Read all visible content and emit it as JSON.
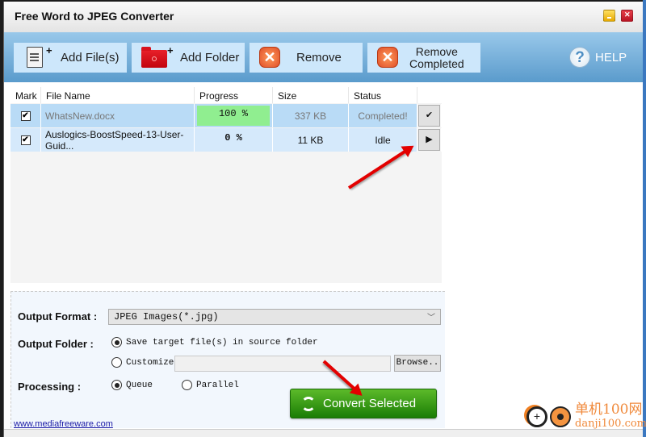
{
  "window": {
    "title": "Free Word to JPEG Converter"
  },
  "toolbar": {
    "add_files": "Add File(s)",
    "add_folder": "Add Folder",
    "remove": "Remove",
    "remove_completed_line1": "Remove",
    "remove_completed_line2": "Completed",
    "help": "HELP"
  },
  "grid": {
    "columns": [
      "Mark",
      "File Name",
      "Progress",
      "Size",
      "Status"
    ],
    "rows": [
      {
        "checked": true,
        "file_name": "WhatsNew.docx",
        "progress": "100 %",
        "progress_value": 100,
        "size": "337 KB",
        "status": "Completed!",
        "action_icon": "checkmark-icon",
        "action_glyph": "✔"
      },
      {
        "checked": true,
        "file_name": "Auslogics-BoostSpeed-13-User-Guid...",
        "progress": "0 %",
        "progress_value": 0,
        "size": "11 KB",
        "status": "Idle",
        "action_icon": "play-icon",
        "action_glyph": "▶"
      }
    ]
  },
  "options": {
    "output_format_label": "Output Format :",
    "output_format_value": "JPEG Images(*.jpg)",
    "output_folder_label": "Output Folder :",
    "save_in_source": "Save target file(s) in source folder",
    "save_in_source_selected": true,
    "customize": "Customize",
    "customize_selected": false,
    "customize_path": "",
    "browse": "Browse..",
    "processing_label": "Processing :",
    "queue": "Queue",
    "queue_selected": true,
    "parallel": "Parallel",
    "parallel_selected": false,
    "convert": "Convert Selected"
  },
  "footer": {
    "website": "www.mediafreeware.com"
  },
  "watermark": {
    "line1": "单机100网",
    "line2": "danji100.com"
  },
  "colors": {
    "toolbar_top": "#99c8ea",
    "toolbar_bottom": "#5a9bcc",
    "row_selected": "#b9dbf6",
    "progress_done": "#90ee90",
    "convert_green": "#2e9a12",
    "annotation_arrow": "#e30000"
  }
}
